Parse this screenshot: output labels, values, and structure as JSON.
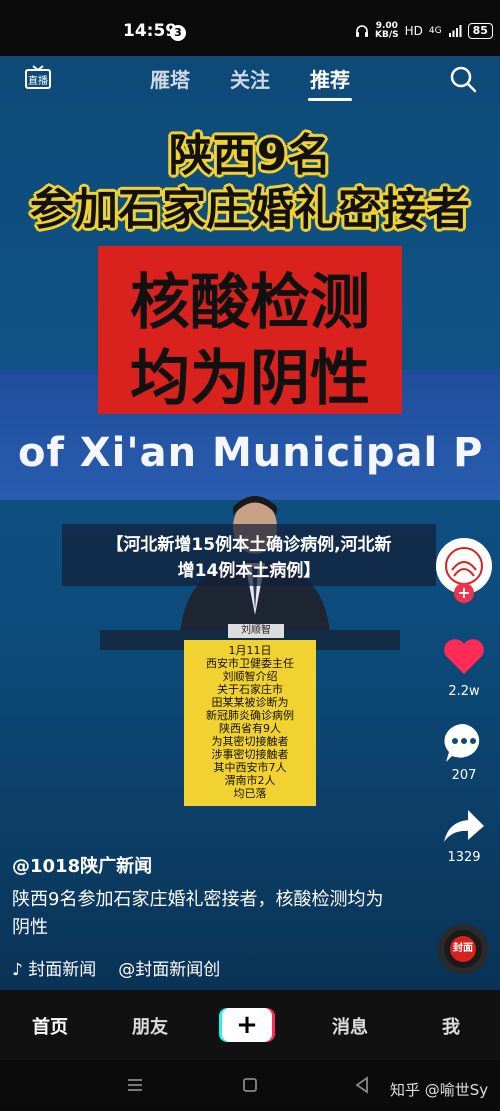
{
  "status": {
    "time": "14:59",
    "notification_count": "3",
    "speed_value": "9.00",
    "speed_unit": "KB/S",
    "hd": "HD",
    "network": "4G",
    "battery": "85"
  },
  "top_tabs": {
    "live_icon": "live-tv-icon",
    "tabs": [
      "雁塔",
      "关注",
      "推荐"
    ],
    "active_tab": "推荐",
    "search_icon": "search-icon"
  },
  "video": {
    "headline_line1": "陕西9名",
    "headline_line2": "参加石家庄婚礼密接者",
    "red_line1": "核酸检测",
    "red_line2": "均为阴性",
    "banner_text": "of Xi'an Municipal P",
    "nameplate": "刘顺智",
    "subtitle_line1": "【河北新增15例本土确诊病例,河北新",
    "subtitle_line2": "增14例本土病例】",
    "notice_lines": [
      "1月11日",
      "西安市卫健委主任",
      "刘顺智介绍",
      "关于石家庄市",
      "田某某被诊断为",
      "新冠肺炎确诊病例",
      "陕西省有9人",
      "为其密切接触者",
      "涉事密切接触者",
      "其中西安市7人",
      "渭南市2人",
      "均已落"
    ]
  },
  "rail": {
    "like_count": "2.2w",
    "comment_count": "207",
    "share_count": "1329",
    "music_label": "封面"
  },
  "post": {
    "author": "@1018陕广新闻",
    "caption": "陕西9名参加石家庄婚礼密接者，核酸检测均为阴性",
    "music_text": "♪ 封面新闻",
    "music_author": "@封面新闻创"
  },
  "bottom_nav": {
    "items": [
      "首页",
      "朋友",
      "消息",
      "我"
    ],
    "plus": "+"
  },
  "watermark": "知乎 @喻世Sy"
}
